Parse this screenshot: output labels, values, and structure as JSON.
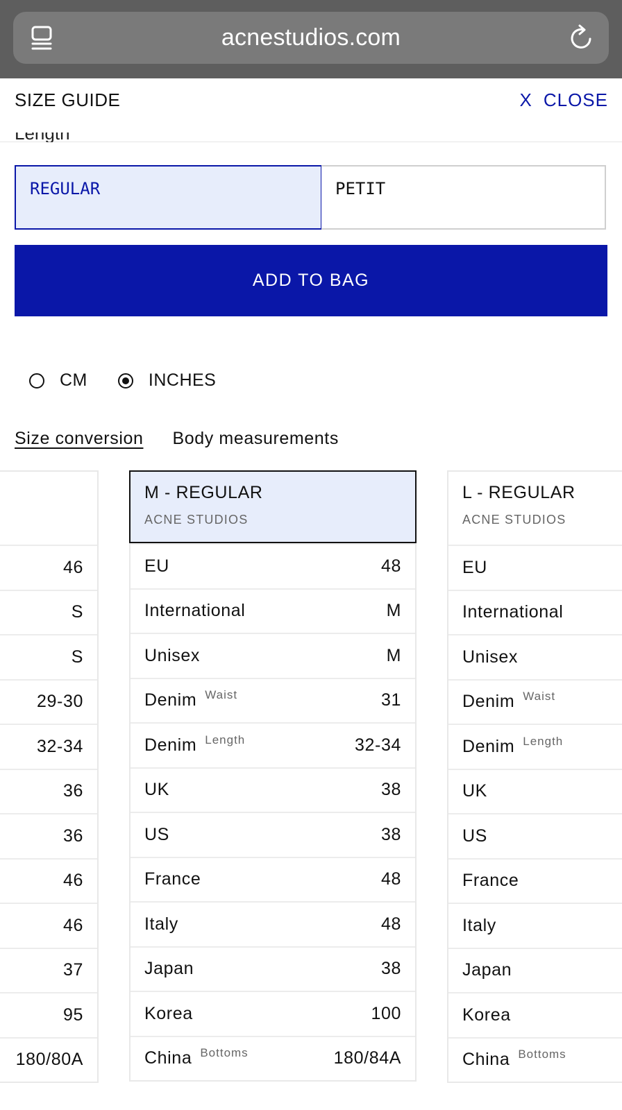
{
  "browser": {
    "url": "acnestudios.com",
    "tabs_icon": "tabs-icon",
    "reload_icon": "reload-icon"
  },
  "header": {
    "title": "SIZE GUIDE",
    "close_x": "X",
    "close_label": "CLOSE"
  },
  "length": {
    "label": "Length",
    "options": [
      "REGULAR",
      "PETIT"
    ],
    "selected": "REGULAR"
  },
  "add_to_bag": "ADD TO BAG",
  "units": {
    "options": [
      "CM",
      "INCHES"
    ],
    "selected": "INCHES"
  },
  "tabs": [
    "Size conversion",
    "Body measurements"
  ],
  "active_tab": "Size conversion",
  "size_table": {
    "left_column_values": [
      "46",
      "S",
      "S",
      "29-30",
      "32-34",
      "36",
      "36",
      "46",
      "46",
      "37",
      "95",
      "180/80A"
    ],
    "middle": {
      "title": "M - REGULAR",
      "brand": "ACNE STUDIOS",
      "rows": [
        {
          "label": "EU",
          "sub": "",
          "value": "48"
        },
        {
          "label": "International",
          "sub": "",
          "value": "M"
        },
        {
          "label": "Unisex",
          "sub": "",
          "value": "M"
        },
        {
          "label": "Denim",
          "sub": "Waist",
          "value": "31"
        },
        {
          "label": "Denim",
          "sub": "Length",
          "value": "32-34"
        },
        {
          "label": "UK",
          "sub": "",
          "value": "38"
        },
        {
          "label": "US",
          "sub": "",
          "value": "38"
        },
        {
          "label": "France",
          "sub": "",
          "value": "48"
        },
        {
          "label": "Italy",
          "sub": "",
          "value": "48"
        },
        {
          "label": "Japan",
          "sub": "",
          "value": "38"
        },
        {
          "label": "Korea",
          "sub": "",
          "value": "100"
        },
        {
          "label": "China",
          "sub": "Bottoms",
          "value": "180/84A"
        }
      ]
    },
    "right": {
      "title": "L - REGULAR",
      "brand": "ACNE STUDIOS",
      "rows": [
        {
          "label": "EU",
          "sub": ""
        },
        {
          "label": "International",
          "sub": ""
        },
        {
          "label": "Unisex",
          "sub": ""
        },
        {
          "label": "Denim",
          "sub": "Waist"
        },
        {
          "label": "Denim",
          "sub": "Length"
        },
        {
          "label": "UK",
          "sub": ""
        },
        {
          "label": "US",
          "sub": ""
        },
        {
          "label": "France",
          "sub": ""
        },
        {
          "label": "Italy",
          "sub": ""
        },
        {
          "label": "Japan",
          "sub": ""
        },
        {
          "label": "Korea",
          "sub": ""
        },
        {
          "label": "China",
          "sub": "Bottoms"
        }
      ]
    }
  },
  "colors": {
    "accent": "#0a17a8",
    "selected_bg": "#e7edfb",
    "chrome": "#5e5e5e"
  }
}
